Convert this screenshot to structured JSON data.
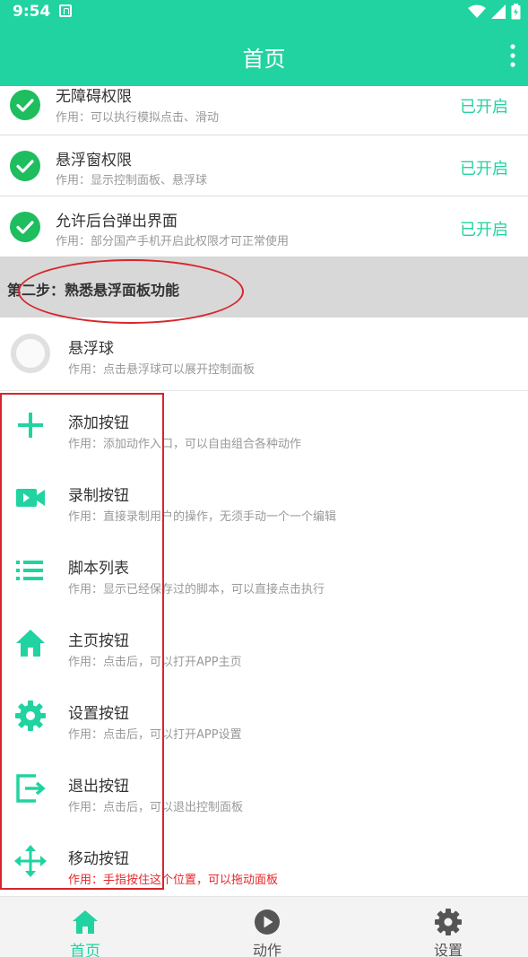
{
  "status_bar": {
    "time": "9:54"
  },
  "app_bar": {
    "title": "首页"
  },
  "permissions": [
    {
      "title": "无障碍权限",
      "desc": "作用：可以执行模拟点击、滑动",
      "status": "已开启"
    },
    {
      "title": "悬浮窗权限",
      "desc": "作用：显示控制面板、悬浮球",
      "status": "已开启"
    },
    {
      "title": "允许后台弹出界面",
      "desc": "作用：部分国产手机开启此权限才可正常使用",
      "status": "已开启"
    }
  ],
  "section": {
    "title": "第二步：熟悉悬浮面板功能"
  },
  "floating_ball": {
    "title": "悬浮球",
    "desc": "作用：点击悬浮球可以展开控制面板"
  },
  "features": [
    {
      "icon": "plus-icon",
      "title": "添加按钮",
      "desc": "作用：添加动作入口，可以自由组合各种动作"
    },
    {
      "icon": "video-camera-icon",
      "title": "录制按钮",
      "desc": "作用：直接录制用户的操作，无须手动一个一个编辑"
    },
    {
      "icon": "list-icon",
      "title": "脚本列表",
      "desc": "作用：显示已经保存过的脚本，可以直接点击执行"
    },
    {
      "icon": "home-icon",
      "title": "主页按钮",
      "desc": "作用：点击后，可以打开APP主页"
    },
    {
      "icon": "gear-icon",
      "title": "设置按钮",
      "desc": "作用：点击后，可以打开APP设置"
    },
    {
      "icon": "exit-icon",
      "title": "退出按钮",
      "desc": "作用：点击后，可以退出控制面板"
    },
    {
      "icon": "move-arrows-icon",
      "title": "移动按钮",
      "desc": "作用：手指按住这个位置，可以拖动面板"
    }
  ],
  "bottom_nav": [
    {
      "label": "首页",
      "icon": "home-icon",
      "active": true
    },
    {
      "label": "动作",
      "icon": "play-icon",
      "active": false
    },
    {
      "label": "设置",
      "icon": "gear-icon",
      "active": false
    }
  ],
  "colors": {
    "accent": "#21D3A0",
    "check_green": "#1EBD5E",
    "annotation_red": "#D7262B",
    "warning_text": "#E8262B"
  }
}
